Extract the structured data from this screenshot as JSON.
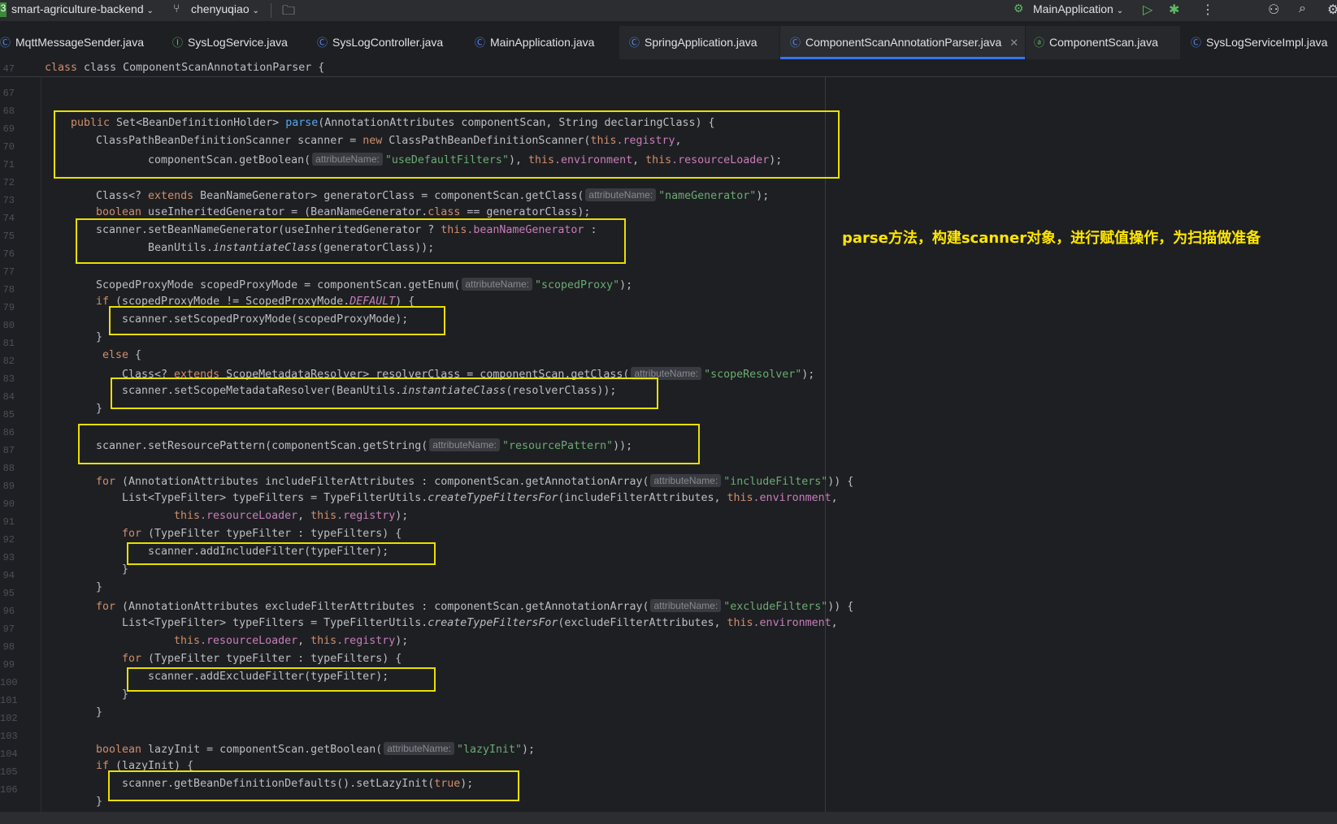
{
  "toolbar": {
    "project": "smart-agriculture-backend",
    "branch": "chenyuqiao",
    "run_config": "MainApplication"
  },
  "tabs": [
    {
      "label": "MqttMessageSender.java"
    },
    {
      "label": "SysLogService.java"
    },
    {
      "label": "SysLogController.java"
    },
    {
      "label": "MainApplication.java"
    },
    {
      "label": "SpringApplication.java"
    },
    {
      "label": "ComponentScanAnnotationParser.java",
      "active": true
    },
    {
      "label": "ComponentScan.java"
    },
    {
      "label": "SysLogServiceImpl.java"
    }
  ],
  "sticky_header": {
    "line": "47",
    "code": "class ComponentScanAnnotationParser {"
  },
  "line_numbers": [
    "67",
    "68",
    "69",
    "70",
    "71",
    "72",
    "73",
    "74",
    "75",
    "76",
    "77",
    "78",
    "79",
    "80",
    "81",
    "82",
    "83",
    "84",
    "85",
    "86",
    "87",
    "88",
    "89",
    "90",
    "91",
    "92",
    "93",
    "94",
    "95",
    "96",
    "97",
    "98",
    "99",
    "100",
    "101",
    "102",
    "103",
    "104",
    "105",
    "106"
  ],
  "hint_label": "attributeName:",
  "code": {
    "l68": {
      "kw": "public",
      "a": " Set<BeanDefinitionHolder> ",
      "fn": "parse",
      "b": "(AnnotationAttributes componentScan, String declaringClass) {"
    },
    "l69": {
      "a": "ClassPathBeanDefinitionScanner scanner = ",
      "kw": "new",
      "b": " ClassPathBeanDefinitionScanner(",
      "kw2": "this",
      "fld": ".registry",
      "c": ","
    },
    "l70": {
      "a": "componentScan.getBoolean(",
      "str": "\"useDefaultFilters\"",
      "b": "), ",
      "kw": "this",
      "fld": ".environment",
      "c": ", ",
      "kw2": "this",
      "fld2": ".resourceLoader",
      "d": ");"
    },
    "l72": {
      "a": "Class<? ",
      "kw": "extends",
      "b": " BeanNameGenerator> generatorClass = componentScan.getClass(",
      "str": "\"nameGenerator\"",
      "c": ");"
    },
    "l73": {
      "kw": "boolean",
      "a": " useInheritedGenerator = (BeanNameGenerator.",
      "kw2": "class",
      "b": " == generatorClass);"
    },
    "l74": {
      "a": "scanner.setBeanNameGenerator(useInheritedGenerator ? ",
      "kw": "this",
      "fld": ".beanNameGenerator",
      "b": " :"
    },
    "l75": {
      "a": "BeanUtils.",
      "it": "instantiateClass",
      "b": "(generatorClass));"
    },
    "l77": {
      "a": "ScopedProxyMode scopedProxyMode = componentScan.getEnum(",
      "str": "\"scopedProxy\"",
      "b": ");"
    },
    "l78": {
      "kw": "if",
      "a": " (scopedProxyMode != ScopedProxyMode.",
      "cst": "DEFAULT",
      "b": ") {"
    },
    "l79": {
      "a": "scanner.setScopedProxyMode(scopedProxyMode);"
    },
    "l80": {
      "a": "}"
    },
    "l81": {
      "kw": "else",
      "a": " {"
    },
    "l82": {
      "a": "Class<? ",
      "kw": "extends",
      "b": " ScopeMetadataResolver> resolverClass = componentScan.getClass(",
      "str": "\"scopeResolver\"",
      "c": ");"
    },
    "l83": {
      "a": "scanner.setScopeMetadataResolver(BeanUtils.",
      "it": "instantiateClass",
      "b": "(resolverClass));"
    },
    "l84": {
      "a": "}"
    },
    "l86": {
      "a": "scanner.setResourcePattern(componentScan.getString(",
      "str": "\"resourcePattern\"",
      "b": "));"
    },
    "l88": {
      "kw": "for",
      "a": " (AnnotationAttributes includeFilterAttributes : componentScan.getAnnotationArray(",
      "str": "\"includeFilters\"",
      "b": ")) {"
    },
    "l89": {
      "a": "List<TypeFilter> typeFilters = TypeFilterUtils.",
      "it": "createTypeFiltersFor",
      "b": "(includeFilterAttributes, ",
      "kw": "this",
      "fld": ".environment",
      "c": ","
    },
    "l90": {
      "kw": "this",
      "fld": ".resourceLoader",
      "a": ", ",
      "kw2": "this",
      "fld2": ".registry",
      "b": ");"
    },
    "l91": {
      "kw": "for",
      "a": " (TypeFilter typeFilter : typeFilters) {"
    },
    "l92": {
      "a": "scanner.addIncludeFilter(typeFilter);"
    },
    "l93": {
      "a": "}"
    },
    "l94": {
      "a": "}"
    },
    "l95": {
      "kw": "for",
      "a": " (AnnotationAttributes excludeFilterAttributes : componentScan.getAnnotationArray(",
      "str": "\"excludeFilters\"",
      "b": ")) {"
    },
    "l96": {
      "a": "List<TypeFilter> typeFilters = TypeFilterUtils.",
      "it": "createTypeFiltersFor",
      "b": "(excludeFilterAttributes, ",
      "kw": "this",
      "fld": ".environment",
      "c": ","
    },
    "l97": {
      "kw": "this",
      "fld": ".resourceLoader",
      "a": ", ",
      "kw2": "this",
      "fld2": ".registry",
      "b": ");"
    },
    "l98": {
      "kw": "for",
      "a": " (TypeFilter typeFilter : typeFilters) {"
    },
    "l99": {
      "a": "scanner.addExcludeFilter(typeFilter);"
    },
    "l100": {
      "a": "}"
    },
    "l101": {
      "a": "}"
    },
    "l103": {
      "kw": "boolean",
      "a": " lazyInit = componentScan.getBoolean(",
      "str": "\"lazyInit\"",
      "b": ");"
    },
    "l104": {
      "kw": "if",
      "a": " (lazyInit) {"
    },
    "l105": {
      "a": "scanner.getBeanDefinitionDefaults().setLazyInit(",
      "kw": "true",
      "b": ");"
    },
    "l106": {
      "a": "}"
    }
  },
  "annotation": "parse方法，构建scanner对象，进行赋值操作，为扫描做准备",
  "colors": {
    "highlight_box": "#e8e000",
    "annotation_text": "#ffe600",
    "accent": "#3574f0"
  }
}
